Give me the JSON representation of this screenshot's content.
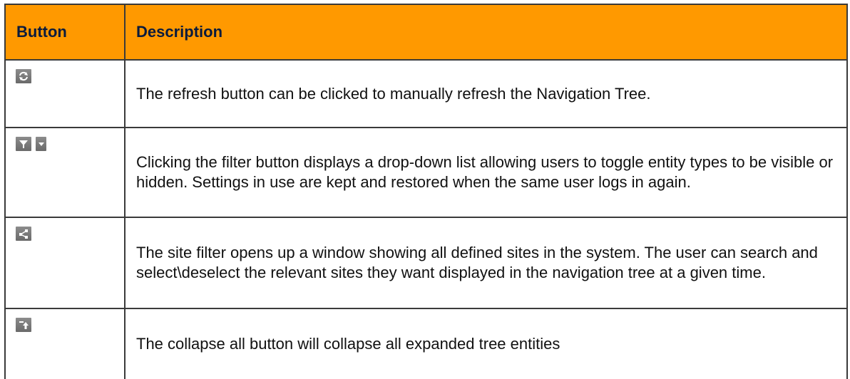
{
  "table": {
    "headers": {
      "button": "Button",
      "description": "Description"
    },
    "rows": [
      {
        "icon": "refresh-icon",
        "description": "The refresh button can be clicked to manually refresh the Navigation Tree."
      },
      {
        "icon": "filter-dropdown-icon",
        "description": "Clicking the filter button displays a drop-down list allowing users to toggle entity types to be visible or hidden. Settings in use are kept and restored when the same user logs in again."
      },
      {
        "icon": "site-filter-icon",
        "description": "The site filter opens up a window showing all defined sites in the system. The user can search and select\\deselect the relevant sites they want displayed in the navigation tree at a given time."
      },
      {
        "icon": "collapse-all-icon",
        "description": "The collapse all button will collapse all expanded tree entities"
      }
    ]
  },
  "colors": {
    "header_background": "#ff9900",
    "header_text": "#0a1b3d",
    "border": "#3a3a3a",
    "icon_background": "#7a7a7a"
  }
}
